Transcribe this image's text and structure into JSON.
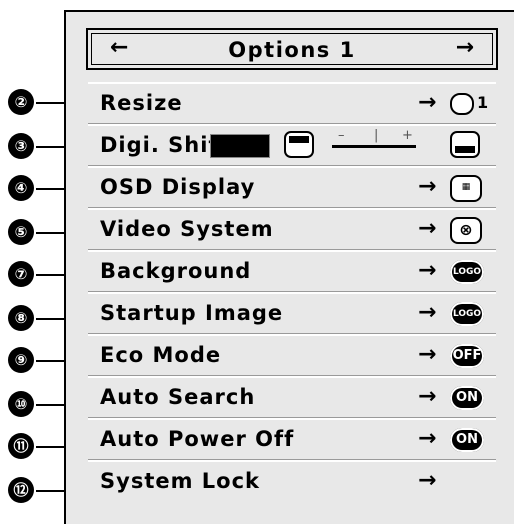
{
  "menu": {
    "title": "Options 1",
    "left_arrow": "←",
    "right_arrow": "→"
  },
  "callouts": [
    "②",
    "③",
    "④",
    "⑤",
    "⑦",
    "⑧",
    "⑨",
    "⑩",
    "⑪",
    "⑫"
  ],
  "items": [
    {
      "label": "Resize",
      "icon": "resize-icon",
      "value": "1"
    },
    {
      "label": "Digi. Shift",
      "icon": "digi-shift-slider",
      "minus": "–",
      "plus": "+"
    },
    {
      "label": "OSD Display",
      "icon": "osd-display-icon",
      "glyph": "▦"
    },
    {
      "label": "Video System",
      "icon": "video-system-icon",
      "glyph": "⊗"
    },
    {
      "label": "Background",
      "icon": "logo-icon",
      "badge": "LOGO"
    },
    {
      "label": "Startup Image",
      "icon": "logo-icon",
      "badge": "LOGO"
    },
    {
      "label": "Eco Mode",
      "icon": "off-icon",
      "badge": "OFF"
    },
    {
      "label": "Auto Search",
      "icon": "on-icon",
      "badge": "ON"
    },
    {
      "label": "Auto Power Off",
      "icon": "on-icon",
      "badge": "ON"
    },
    {
      "label": "System Lock",
      "icon": "arrow-right-icon"
    }
  ],
  "row_arrow": "→"
}
